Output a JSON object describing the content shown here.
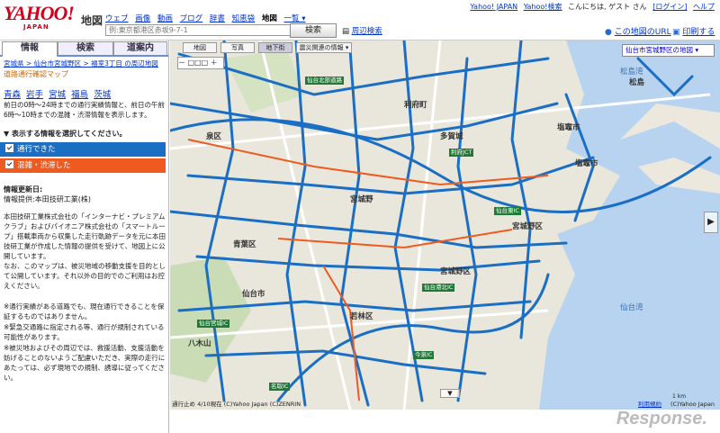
{
  "header": {
    "logo_text": "YAHOO!",
    "logo_sub": "JAPAN",
    "service": "地図",
    "services": [
      "ウェブ",
      "画像",
      "動画",
      "ブログ",
      "辞書",
      "知恵袋",
      "地図",
      "一覧 ▾"
    ],
    "top_links": [
      "Yahoo! JAPAN",
      "Yahoo!検索",
      "こんにちは, ゲスト さん",
      "[ログイン]",
      "ヘルプ"
    ],
    "search_placeholder": "例:東京都港区赤坂9-7-1",
    "search_button": "検索",
    "nearby_link": "周辺検索",
    "map_url_link": "この地図のURL",
    "print_link": "印刷する"
  },
  "sidebar": {
    "tabs": [
      "情報",
      "検索",
      "道案内"
    ],
    "breadcrumb": "宮城県 > 仙台市宮城野区 > 福室3丁目 の周辺地図",
    "page_title": "道路通行確認マップ",
    "prefectures": [
      "青森",
      "岩手",
      "宮城",
      "福島",
      "茨城"
    ],
    "description": "前日の0時〜24時までの通行実績情報と、前日の午前6時〜10時までの混雑・渋滞情報を表示します。",
    "select_heading": "表示する情報を選択してください。",
    "legend": {
      "passable": "通行できた",
      "congested": "混雑・渋滞した"
    },
    "legend_colors": {
      "passable": "#1a6fc4",
      "congested": "#ef5a1e"
    },
    "info_date": "情報更新日:",
    "info_provider": "情報提供:本田技研工業(株)",
    "paragraphs": [
      "本田技研工業株式会社の「インターナビ・プレミアムクラブ」およびパイオニア株式会社の「スマートループ」搭載車両から収集した走行軌跡データを元に本田技研工業が作成した情報の提供を受けて、地図上に公開しています。",
      "なお、このマップは、被災地域の移動支援を目的として公開しています。それ以外の目的でのご利用はお控えください。",
      "※通行実績がある道路でも、現在通行できることを保証するものではありません。",
      "※緊急交通路に指定される等、通行が規制されている可能性があります。",
      "※被災地およびその周辺では、救援活動、支援活動を妨げることのないようご配慮いただき、実際の走行にあたっては、必ず現地での規制、誘導に従ってください。"
    ]
  },
  "map": {
    "modes": [
      "地図",
      "写真",
      "地下街"
    ],
    "overlay_select": "震災関連の情報 ▾",
    "area_select": "仙台市宮城野区の地図 ▾",
    "zoom": "－ □□□ ＋",
    "labels": [
      "塩竈市",
      "多賀城",
      "利府町",
      "泉区",
      "仙台市",
      "若林区",
      "宮城野区",
      "宮城野",
      "青葉区",
      "松島",
      "八木山",
      "宮城野区",
      "塩竈市"
    ],
    "sea_labels": [
      "松島湾",
      "仙台湾"
    ],
    "ic_labels": [
      "仙台北部道路",
      "利府JCT",
      "仙台東IC",
      "仙台宮城IC",
      "仙台港北IC",
      "名取IC",
      "今泉IC"
    ],
    "copyright": "通行止め 4/10現在 (C)Yahoo Japan (C)ZENRIN",
    "help": "利用規約",
    "copyright2": "(C)Yahoo Japan",
    "scale": "1 km",
    "watermark": "Response."
  }
}
